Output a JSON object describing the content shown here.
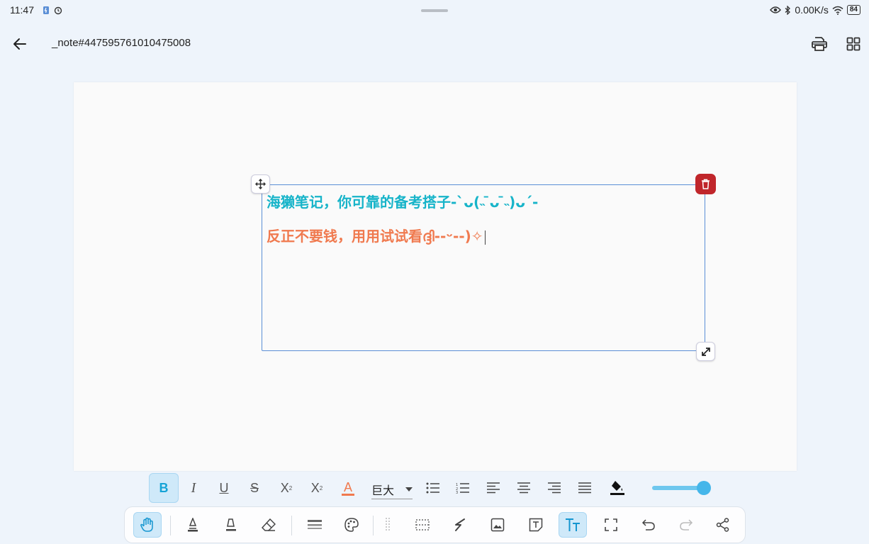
{
  "status_bar": {
    "time": "11:47",
    "net_speed": "0.00K/s",
    "battery": "84",
    "icons": [
      "battery-saver-icon",
      "alarm-icon",
      "eye-icon",
      "bluetooth-icon",
      "wifi-icon"
    ]
  },
  "header": {
    "title": "_note#447595761010475008",
    "back_icon": "arrow-left-icon",
    "right_icons": [
      "printer-icon",
      "grid-icon"
    ]
  },
  "textbox": {
    "line1": "海獭笔记，你可靠的备考搭子-ˋ̀ᴗ(˵ ̄ᴗ ̄˵)ᴗˊ́-",
    "line2": "反正不要钱，用用试试看ദ്ദി--ᵕ--)✧",
    "line1_color": "#17b4c9",
    "line2_color": "#f07a4f"
  },
  "format_toolbar": {
    "bold": "B",
    "italic": "I",
    "underline": "U",
    "strike": "S",
    "superscript": "X",
    "subscript": "X",
    "font_color_glyph": "A",
    "font_color": "#f07a4f",
    "font_size": "巨大",
    "opacity": 0.85,
    "accent": "#45b6ea"
  },
  "tools": [
    "hand-icon",
    "pen-icon",
    "highlighter-icon",
    "eraser-icon",
    "line-style-icon",
    "palette-icon",
    "ruler-icon",
    "lasso-icon",
    "lightning-icon",
    "image-icon",
    "sticky-note-icon",
    "text-tool-icon",
    "fullscreen-icon",
    "undo-icon",
    "redo-icon",
    "share-icon"
  ]
}
